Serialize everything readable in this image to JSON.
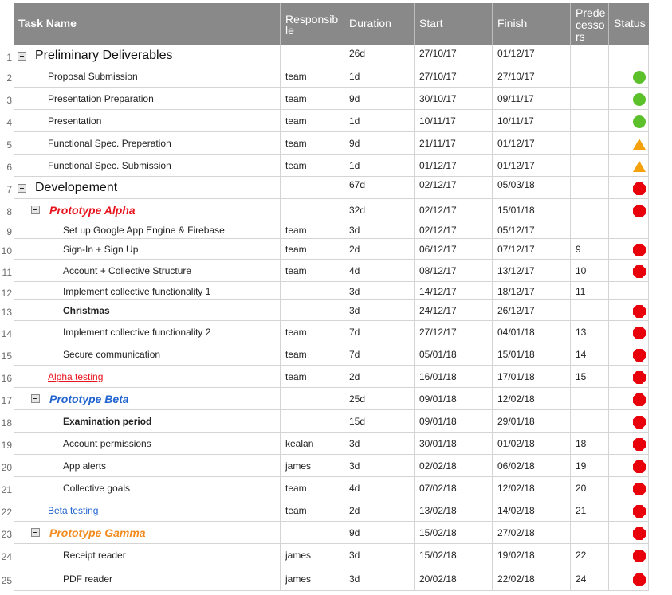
{
  "columns": [
    {
      "key": "name",
      "label": "Task Name"
    },
    {
      "key": "responsible",
      "label": "Responsible"
    },
    {
      "key": "duration",
      "label": "Duration"
    },
    {
      "key": "start",
      "label": "Start"
    },
    {
      "key": "finish",
      "label": "Finish"
    },
    {
      "key": "predecessors",
      "label": "Predecessors"
    },
    {
      "key": "status",
      "label": "Status"
    }
  ],
  "header_wrapped": {
    "responsible": [
      "Responsib",
      "le"
    ],
    "predecessors": [
      "Prede",
      "cesso",
      "rs"
    ]
  },
  "colors": {
    "header_bg": "#898989",
    "green": "#5cc02a",
    "orange": "#f4a10b",
    "red": "#e8000b",
    "alpha_red": "#e8141e",
    "beta_blue": "#2164d0",
    "gamma_orange": "#f28b1d"
  },
  "rows": [
    {
      "num": "1",
      "name": "Preliminary Deliverables",
      "level": 0,
      "style": "group",
      "toggle": true,
      "responsible": "",
      "duration": "26d",
      "start": "27/10/17",
      "finish": "01/12/17",
      "pred": "",
      "status": ""
    },
    {
      "num": "2",
      "name": "Proposal Submission",
      "level": 1,
      "style": "task",
      "responsible": "team",
      "duration": "1d",
      "start": "27/10/17",
      "finish": "27/10/17",
      "pred": "",
      "status": "green-circle"
    },
    {
      "num": "3",
      "name": "Presentation Preparation",
      "level": 1,
      "style": "task",
      "responsible": "team",
      "duration": "9d",
      "start": "30/10/17",
      "finish": "09/11/17",
      "pred": "",
      "status": "green-circle"
    },
    {
      "num": "4",
      "name": "Presentation",
      "level": 1,
      "style": "task",
      "responsible": "team",
      "duration": "1d",
      "start": "10/11/17",
      "finish": "10/11/17",
      "pred": "",
      "status": "green-circle"
    },
    {
      "num": "5",
      "name": "Functional Spec. Preperation",
      "level": 1,
      "style": "task",
      "responsible": "team",
      "duration": "9d",
      "start": "21/11/17",
      "finish": "01/12/17",
      "pred": "",
      "status": "orange-triangle"
    },
    {
      "num": "6",
      "name": "Functional Spec. Submission",
      "level": 1,
      "style": "task",
      "responsible": "team",
      "duration": "1d",
      "start": "01/12/17",
      "finish": "01/12/17",
      "pred": "",
      "status": "orange-triangle"
    },
    {
      "num": "7",
      "name": "Developement",
      "level": 0,
      "style": "group",
      "toggle": true,
      "responsible": "",
      "duration": "67d",
      "start": "02/12/17",
      "finish": "05/03/18",
      "pred": "",
      "status": "red-octagon"
    },
    {
      "num": "8",
      "name": "Prototype Alpha",
      "level": 1,
      "style": "sub-alpha",
      "toggle": true,
      "responsible": "",
      "duration": "32d",
      "start": "02/12/17",
      "finish": "15/01/18",
      "pred": "",
      "status": "red-octagon"
    },
    {
      "num": "9",
      "name": "Set up Google App Engine & Firebase",
      "level": 2,
      "style": "task",
      "responsible": "team",
      "duration": "3d",
      "start": "02/12/17",
      "finish": "05/12/17",
      "pred": "",
      "status": ""
    },
    {
      "num": "10",
      "name": "Sign-In + Sign Up",
      "level": 2,
      "style": "task",
      "responsible": "team",
      "duration": "2d",
      "start": "06/12/17",
      "finish": "07/12/17",
      "pred": "9",
      "status": "red-octagon"
    },
    {
      "num": "11",
      "name": "Account + Collective Structure",
      "level": 2,
      "style": "task",
      "responsible": "team",
      "duration": "4d",
      "start": "08/12/17",
      "finish": "13/12/17",
      "pred": "10",
      "status": "red-octagon"
    },
    {
      "num": "12",
      "name": "Implement collective functionality 1",
      "level": 2,
      "style": "task",
      "responsible": "",
      "duration": "3d",
      "start": "14/12/17",
      "finish": "18/12/17",
      "pred": "11",
      "status": ""
    },
    {
      "num": "13",
      "name": "Christmas",
      "level": 2,
      "style": "bold",
      "responsible": "",
      "duration": "3d",
      "start": "24/12/17",
      "finish": "26/12/17",
      "pred": "",
      "status": "red-octagon"
    },
    {
      "num": "14",
      "name": "Implement collective functionality 2",
      "level": 2,
      "style": "task",
      "responsible": "team",
      "duration": "7d",
      "start": "27/12/17",
      "finish": "04/01/18",
      "pred": "13",
      "status": "red-octagon"
    },
    {
      "num": "15",
      "name": "Secure communication",
      "level": 2,
      "style": "task",
      "responsible": "team",
      "duration": "7d",
      "start": "05/01/18",
      "finish": "15/01/18",
      "pred": "14",
      "status": "red-octagon"
    },
    {
      "num": "16",
      "name": "Alpha testing",
      "level": 1,
      "style": "milestone-alpha",
      "responsible": "team",
      "duration": "2d",
      "start": "16/01/18",
      "finish": "17/01/18",
      "pred": "15",
      "status": "red-octagon"
    },
    {
      "num": "17",
      "name": "Prototype Beta",
      "level": 1,
      "style": "sub-beta",
      "toggle": true,
      "responsible": "",
      "duration": "25d",
      "start": "09/01/18",
      "finish": "12/02/18",
      "pred": "",
      "status": "red-octagon"
    },
    {
      "num": "18",
      "name": "Examination period",
      "level": 2,
      "style": "bold",
      "responsible": "",
      "duration": "15d",
      "start": "09/01/18",
      "finish": "29/01/18",
      "pred": "",
      "status": "red-octagon"
    },
    {
      "num": "19",
      "name": "Account permissions",
      "level": 2,
      "style": "task",
      "responsible": "kealan",
      "duration": "3d",
      "start": "30/01/18",
      "finish": "01/02/18",
      "pred": "18",
      "status": "red-octagon"
    },
    {
      "num": "20",
      "name": "App alerts",
      "level": 2,
      "style": "task",
      "responsible": "james",
      "duration": "3d",
      "start": "02/02/18",
      "finish": "06/02/18",
      "pred": "19",
      "status": "red-octagon"
    },
    {
      "num": "21",
      "name": "Collective goals",
      "level": 2,
      "style": "task",
      "responsible": "team",
      "duration": "4d",
      "start": "07/02/18",
      "finish": "12/02/18",
      "pred": "20",
      "status": "red-octagon"
    },
    {
      "num": "22",
      "name": "Beta testing",
      "level": 1,
      "style": "milestone-beta",
      "responsible": "team",
      "duration": "2d",
      "start": "13/02/18",
      "finish": "14/02/18",
      "pred": "21",
      "status": "red-octagon"
    },
    {
      "num": "23",
      "name": "Prototype Gamma",
      "level": 1,
      "style": "sub-gamma",
      "toggle": true,
      "responsible": "",
      "duration": "9d",
      "start": "15/02/18",
      "finish": "27/02/18",
      "pred": "",
      "status": "red-octagon"
    },
    {
      "num": "24",
      "name": "Receipt reader",
      "level": 2,
      "style": "task",
      "responsible": "james",
      "duration": "3d",
      "start": "15/02/18",
      "finish": "19/02/18",
      "pred": "22",
      "status": "red-octagon"
    },
    {
      "num": "25",
      "name": "PDF reader",
      "level": 2,
      "style": "task",
      "responsible": "james",
      "duration": "3d",
      "start": "20/02/18",
      "finish": "22/02/18",
      "pred": "24",
      "status": "red-octagon"
    }
  ]
}
